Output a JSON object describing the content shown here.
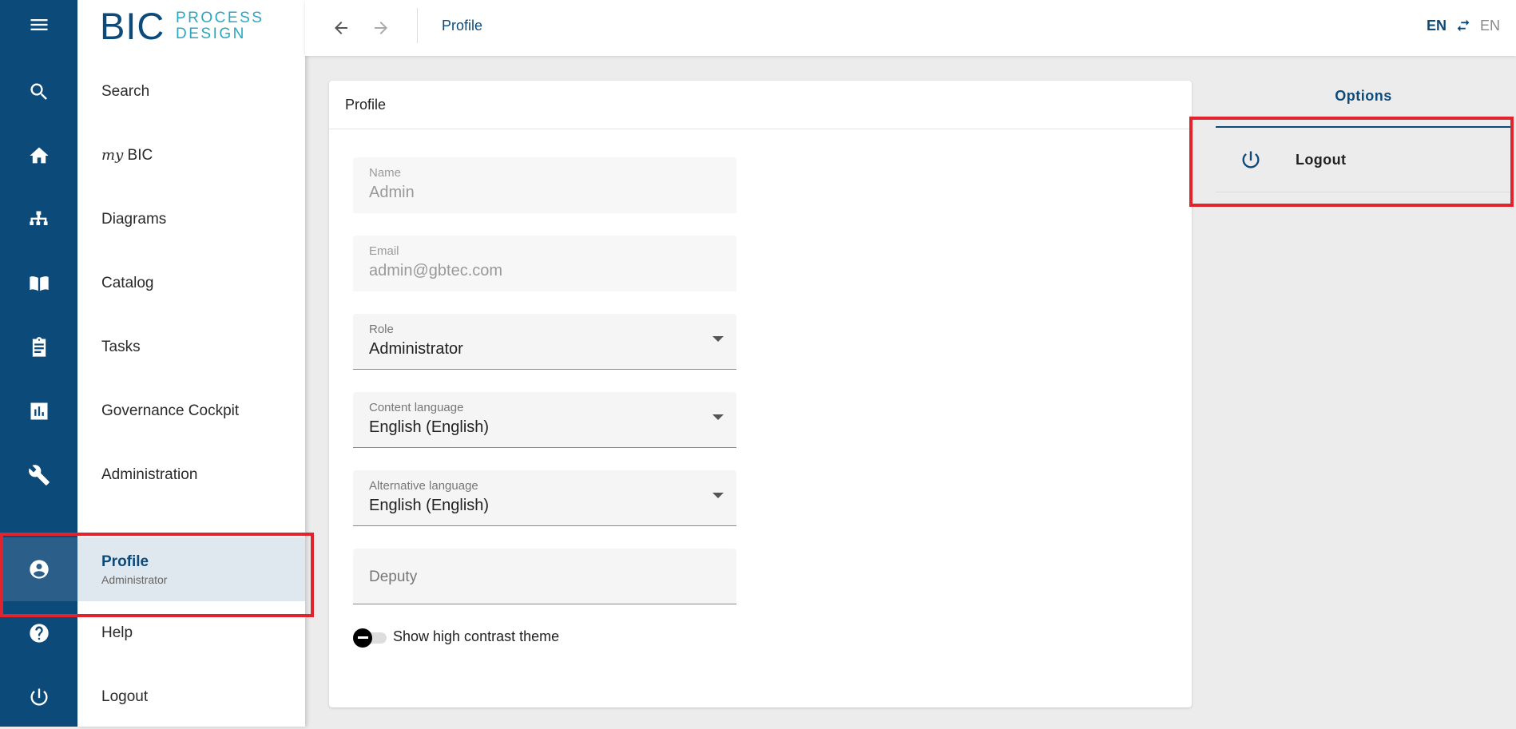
{
  "brand": {
    "logo_main": "BIC",
    "logo_line1": "PROCESS",
    "logo_line2": "DESIGN"
  },
  "nav": {
    "items": [
      {
        "label": "Search",
        "icon": "search-icon"
      },
      {
        "prefix": "my",
        "label": "BIC",
        "icon": "home-icon"
      },
      {
        "label": "Diagrams",
        "icon": "sitemap-icon"
      },
      {
        "label": "Catalog",
        "icon": "book-icon"
      },
      {
        "label": "Tasks",
        "icon": "clipboard-icon"
      },
      {
        "label": "Governance Cockpit",
        "icon": "chart-icon"
      },
      {
        "label": "Administration",
        "icon": "wrench-icon"
      },
      {
        "label": "Profile",
        "sublabel": "Administrator",
        "icon": "account-icon",
        "active": true
      },
      {
        "label": "Help",
        "icon": "help-icon"
      },
      {
        "label": "Logout",
        "icon": "power-icon"
      }
    ]
  },
  "topbar": {
    "title": "Profile",
    "lang_primary": "EN",
    "lang_secondary": "EN"
  },
  "profile": {
    "title": "Profile",
    "name": {
      "label": "Name",
      "value": "Admin"
    },
    "email": {
      "label": "Email",
      "value": "admin@gbtec.com"
    },
    "role": {
      "label": "Role",
      "value": "Administrator"
    },
    "content_language": {
      "label": "Content language",
      "value": "English (English)"
    },
    "alternative_language": {
      "label": "Alternative language",
      "value": "English (English)"
    },
    "deputy": {
      "label": "Deputy",
      "value": ""
    },
    "high_contrast": {
      "label": "Show high contrast theme",
      "enabled": false
    }
  },
  "options": {
    "title": "Options",
    "items": [
      {
        "label": "Logout",
        "icon": "power-icon"
      }
    ]
  },
  "colors": {
    "primary": "#0c4a7a",
    "highlight": "#e0232c",
    "accent": "#2ba6c0"
  }
}
